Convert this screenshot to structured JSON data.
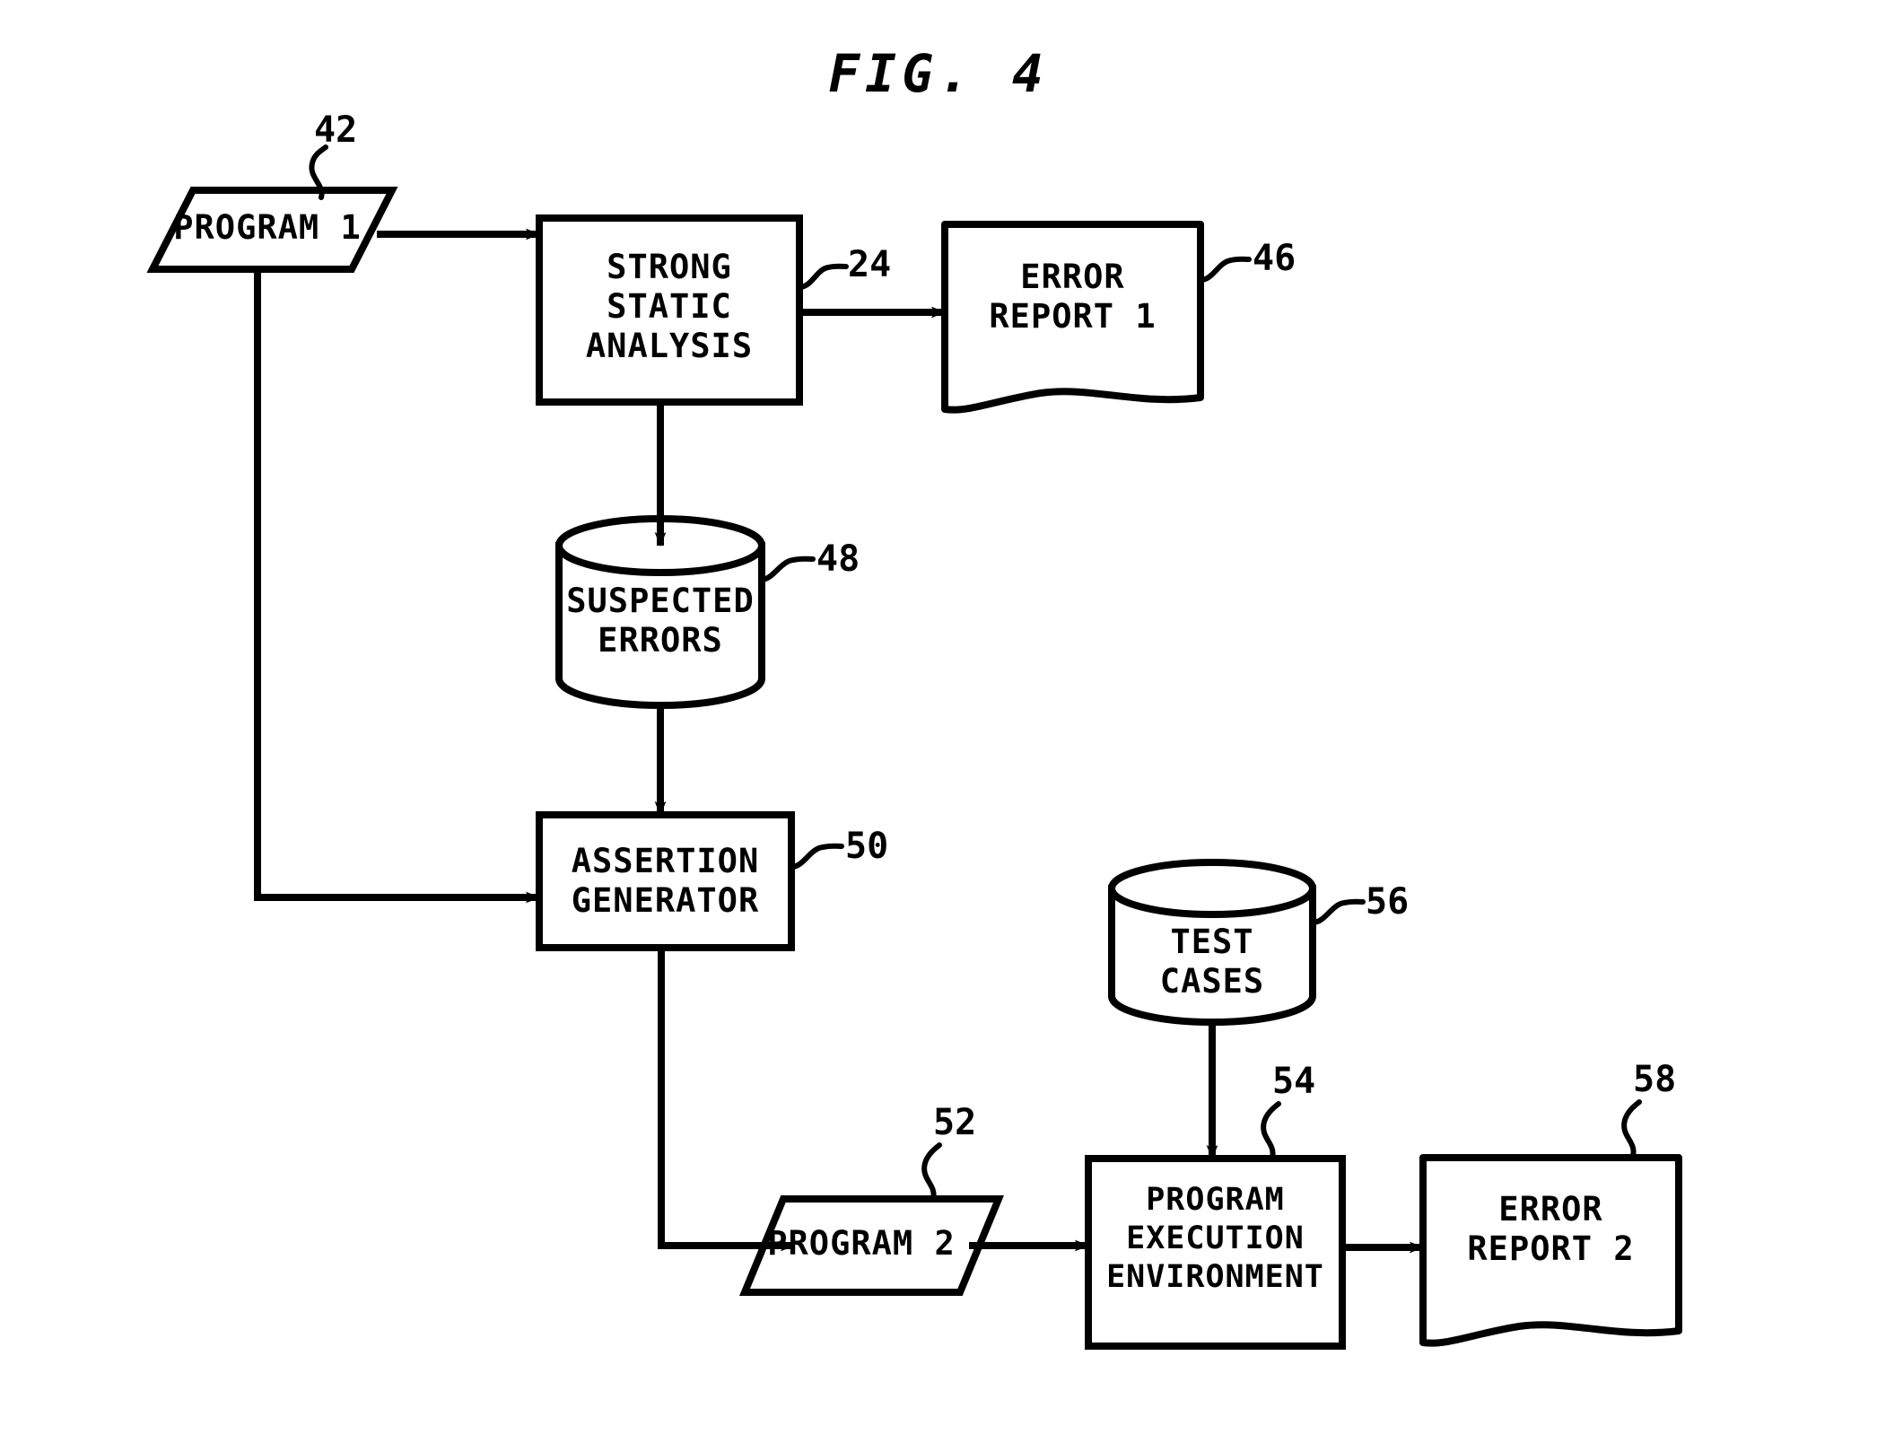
{
  "figure": {
    "title": "FIG. 4",
    "stroke_color": "#000000",
    "background_color": "#ffffff"
  },
  "nodes": [
    {
      "id": "program-1",
      "shape": "parallelogram",
      "label": "PROGRAM 1",
      "ref": "42"
    },
    {
      "id": "strong-static-analysis",
      "shape": "rectangle",
      "label": "STRONG\nSTATIC\nANALYSIS",
      "ref": "24"
    },
    {
      "id": "error-report-1",
      "shape": "document",
      "label": "ERROR\nREPORT 1",
      "ref": "46"
    },
    {
      "id": "suspected-errors",
      "shape": "cylinder",
      "label": "SUSPECTED\nERRORS",
      "ref": "48"
    },
    {
      "id": "assertion-generator",
      "shape": "rectangle",
      "label": "ASSERTION\nGENERATOR",
      "ref": "50"
    },
    {
      "id": "test-cases",
      "shape": "cylinder",
      "label": "TEST\nCASES",
      "ref": "56"
    },
    {
      "id": "program-2",
      "shape": "parallelogram",
      "label": "PROGRAM 2",
      "ref": "52"
    },
    {
      "id": "program-execution-environment",
      "shape": "rectangle",
      "label": "PROGRAM\nEXECUTION\nENVIRONMENT",
      "ref": "54"
    },
    {
      "id": "error-report-2",
      "shape": "document",
      "label": "ERROR\nREPORT 2",
      "ref": "58"
    }
  ],
  "edges": [
    {
      "from": "program-1",
      "to": "strong-static-analysis",
      "style": "arrow"
    },
    {
      "from": "strong-static-analysis",
      "to": "error-report-1",
      "style": "arrow"
    },
    {
      "from": "strong-static-analysis",
      "to": "suspected-errors",
      "style": "arrow"
    },
    {
      "from": "suspected-errors",
      "to": "assertion-generator",
      "style": "arrow"
    },
    {
      "from": "program-1",
      "to": "assertion-generator",
      "style": "arrow"
    },
    {
      "from": "assertion-generator",
      "to": "program-2",
      "style": "arrow"
    },
    {
      "from": "program-2",
      "to": "program-execution-environment",
      "style": "arrow"
    },
    {
      "from": "test-cases",
      "to": "program-execution-environment",
      "style": "arrow"
    },
    {
      "from": "program-execution-environment",
      "to": "error-report-2",
      "style": "arrow"
    }
  ]
}
